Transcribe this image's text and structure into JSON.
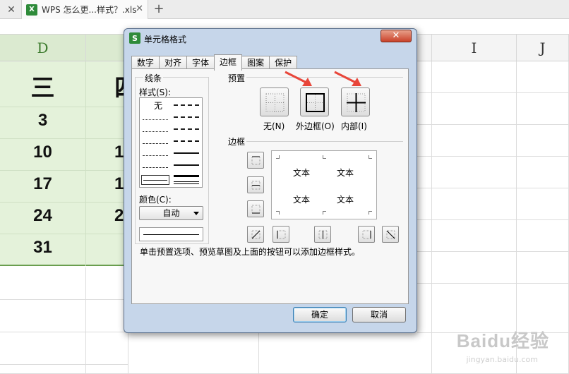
{
  "tabbar": {
    "doc_tab_title": "WPS 怎么更...样式？.xls",
    "xls_icon_text": "X",
    "new_tab": "+",
    "close_glyph": "✕"
  },
  "sheet": {
    "columns": [
      "D",
      "",
      "I",
      "J"
    ],
    "header_row": [
      "三",
      "四"
    ],
    "values_d": [
      "3",
      "10",
      "17",
      "24",
      "31"
    ],
    "values_e": [
      "",
      "1",
      "1",
      "2",
      ""
    ]
  },
  "dialog": {
    "app_icon": "S",
    "title": "单元格格式",
    "close_glyph": "✕",
    "tabs": [
      "数字",
      "对齐",
      "字体",
      "边框",
      "图案",
      "保护"
    ],
    "active_tab": "边框",
    "line_group": {
      "label": "线条",
      "style_label": "样式(S):",
      "none_label": "无",
      "color_label": "颜色(C):",
      "color_value": "自动"
    },
    "presets": {
      "label": "预置",
      "none": "无(N)",
      "outline": "外边框(O)",
      "inside": "内部(I)"
    },
    "border": {
      "label": "边框",
      "preview_text": [
        "文本",
        "文本",
        "文本",
        "文本"
      ]
    },
    "hint": "单击预置选项、预览草图及上面的按钮可以添加边框样式。",
    "ok": "确定",
    "cancel": "取消"
  },
  "watermark": {
    "text": "Baidu经验",
    "url": "jingyan.baidu.com"
  },
  "colors": {
    "selection_green": "#e4f2da",
    "arrow_red": "#e8463a",
    "dialog_frame": "#c6d6ea"
  }
}
